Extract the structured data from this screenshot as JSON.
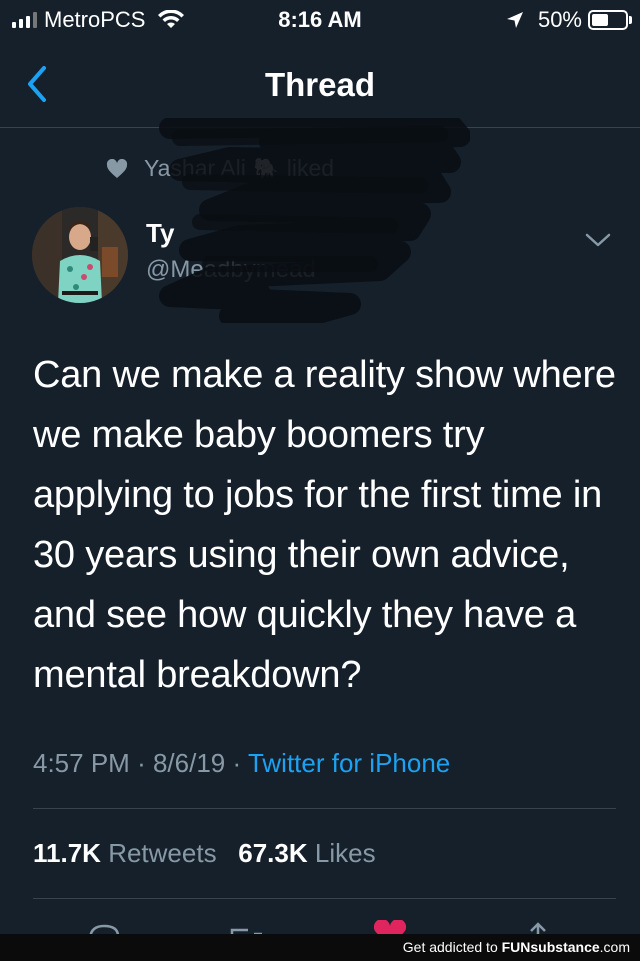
{
  "status_bar": {
    "carrier": "MetroPCS",
    "time": "8:16 AM",
    "battery_percent_label": "50%",
    "battery_level": 0.5,
    "signal_bars": 3
  },
  "nav": {
    "title": "Thread",
    "back_icon": "chevron-left-icon"
  },
  "social_context": {
    "liker": "Yashar Ali",
    "emoji": "🐘",
    "action": "liked"
  },
  "author": {
    "name": "Ty",
    "handle": "@Meadbymead"
  },
  "tweet": {
    "text": "Can we make a reality show where we make baby boomers try applying to jobs for the first time in 30 years using their own advice, and see how quickly they have a mental breakdown?",
    "time": "4:57 PM",
    "date": "8/6/19",
    "separator": "·",
    "source": "Twitter for iPhone"
  },
  "stats": {
    "retweets_count": "11.7K",
    "retweets_label": "Retweets",
    "likes_count": "67.3K",
    "likes_label": "Likes"
  },
  "footer": {
    "prefix": "Get addicted to ",
    "brand": "FUNsubstance",
    "suffix": ".com"
  },
  "colors": {
    "background": "#15202b",
    "text": "#ffffff",
    "secondary_text": "#8899a6",
    "accent": "#1da1f2",
    "divider": "#38444d",
    "like_pink": "#e0245e"
  }
}
